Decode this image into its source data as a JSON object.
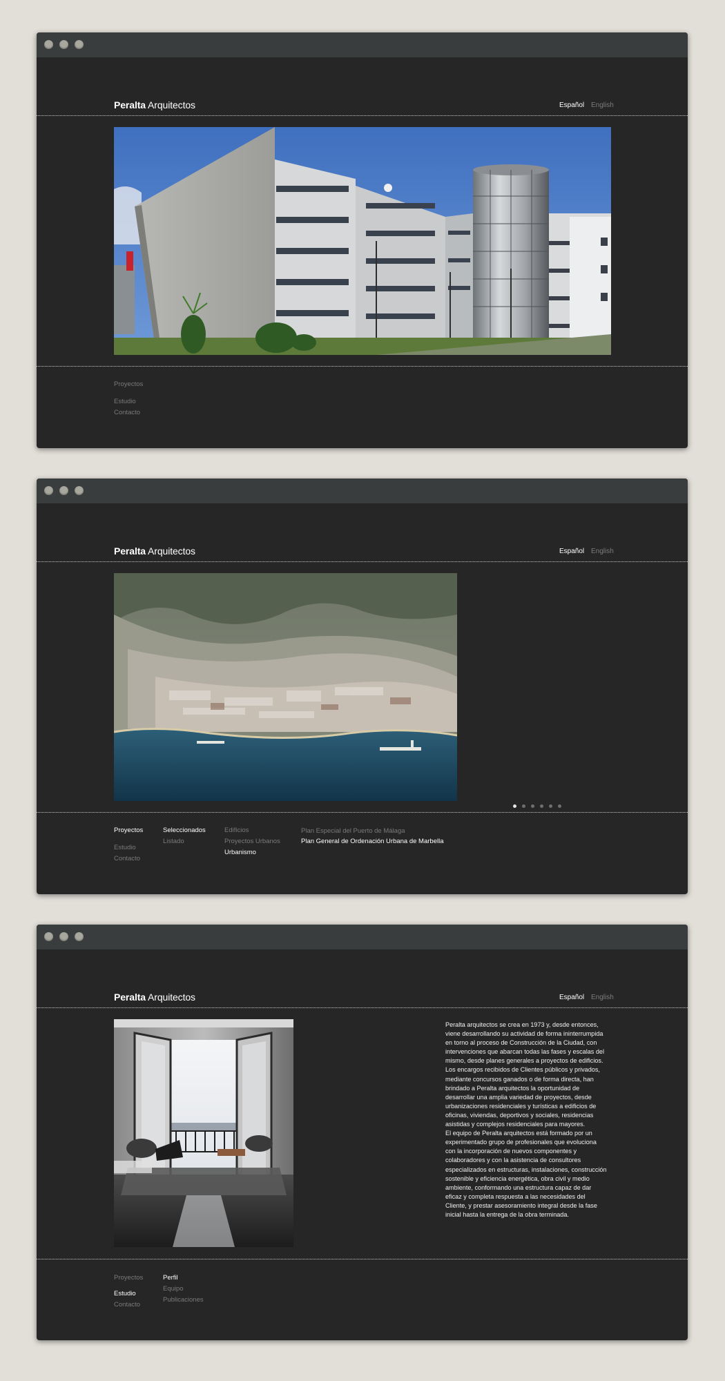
{
  "brand": {
    "bold": "Peralta",
    "rest": " Arquitectos"
  },
  "languages": {
    "es": "Español",
    "en": "English"
  },
  "menu": {
    "proyectos": "Proyectos",
    "estudio": "Estudio",
    "contacto": "Contacto"
  },
  "screen2": {
    "col2": [
      "Seleccionados",
      "Listado"
    ],
    "col3": [
      "Edificios",
      "Proyectos Urbanos",
      "Urbanismo"
    ],
    "col4": [
      "Plan Especial del Puerto de Málaga",
      "Plan General de Ordenación Urbana de Marbella"
    ],
    "slide_count": 6,
    "active_slide": 1
  },
  "screen3": {
    "submenu": [
      "Perfil",
      "Equipo",
      "Publicaciones"
    ],
    "bio": [
      "Peralta arquitectos se crea en 1973 y, desde entonces, viene desarrollando su actividad de forma ininterrumpida en torno al proceso de Construcción de la Ciudad, con intervenciones que abarcan todas las fases y escalas del mismo, desde planes generales a proyectos de edificios.",
      "Los encargos recibidos de Clientes públicos y privados, mediante concursos ganados o de forma directa, han brindado a Peralta arquitectos la oportunidad de desarrollar una amplia variedad de proyectos, desde urbanizaciones residenciales y turísticas a edificios de oficinas, viviendas, deportivos y sociales, residencias asistidas y complejos residenciales para mayores.",
      "El equipo de Peralta arquitectos está formado por un experimentado grupo de profesionales que evoluciona con la incorporación de nuevos componentes y colaboradores y con la asistencia de consultores especializados en estructuras, instalaciones, construcción sostenible y eficiencia energética, obra civil y medio ambiente, conformando una estructura capaz de dar eficaz y completa respuesta a las necesidades del Cliente, y prestar asesoramiento integral desde la fase inicial hasta la entrega de la obra terminada."
    ]
  },
  "colors": {
    "page": "#e2dfd8",
    "window": "#262626",
    "chrome": "#3a3d3e",
    "active": "#ffffff",
    "inactive": "#7a7a7a"
  }
}
